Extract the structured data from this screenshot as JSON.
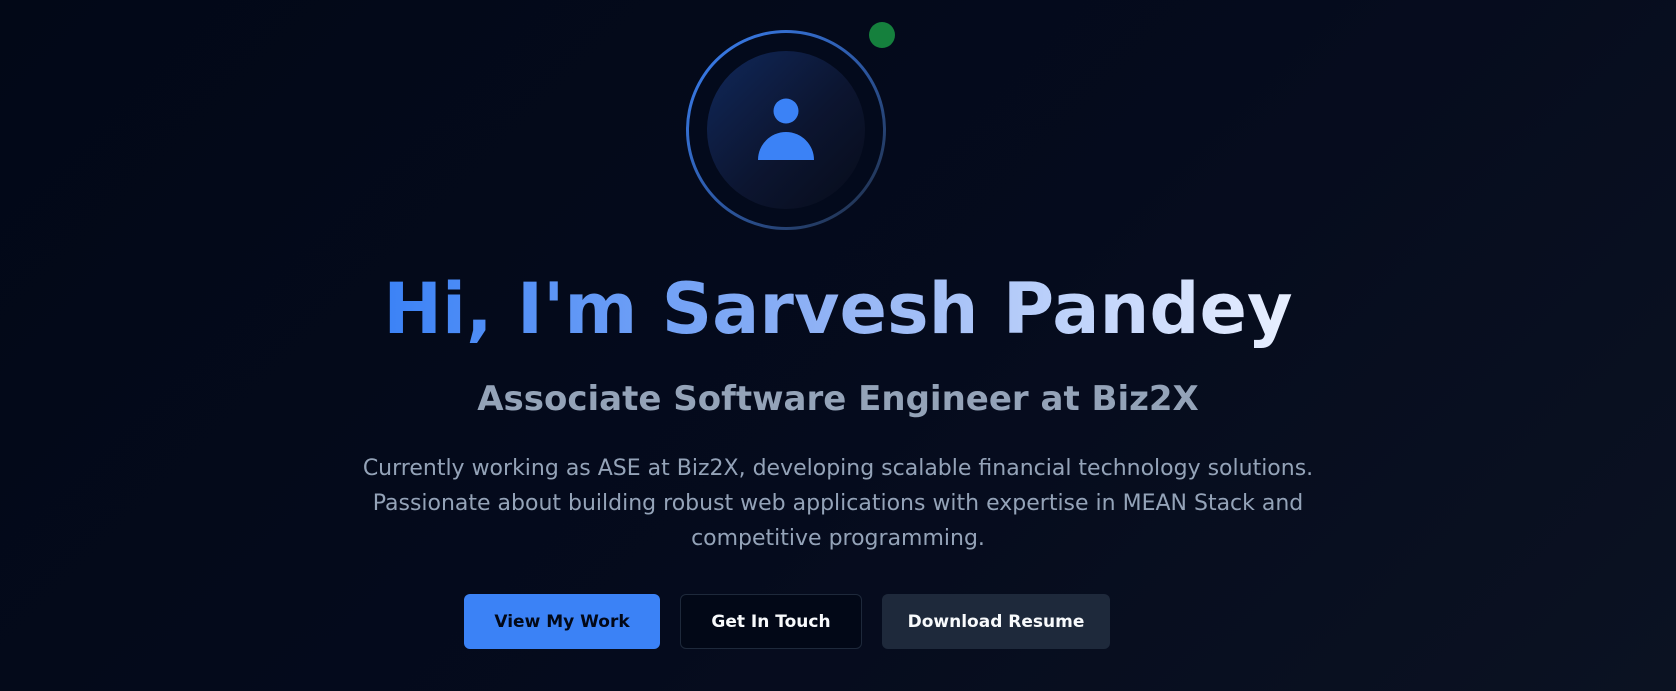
{
  "hero": {
    "avatar_icon": "user-icon",
    "status": "online",
    "status_color": "#15803d",
    "title": "Hi, I'm Sarvesh Pandey",
    "subtitle": "Associate Software Engineer at Biz2X",
    "description_lines": [
      "Currently working as ASE at Biz2X, developing scalable financial technology solutions.",
      "Passionate about building robust web applications with expertise in MEAN Stack and",
      "competitive programming."
    ]
  },
  "actions": {
    "view_work_label": "View My Work",
    "get_in_touch_label": "Get In Touch",
    "download_resume_label": "Download Resume"
  },
  "colors": {
    "accent": "#3b82f6",
    "background": "#020817",
    "muted_text": "#94a3b8",
    "secondary_button": "#1e293b"
  }
}
